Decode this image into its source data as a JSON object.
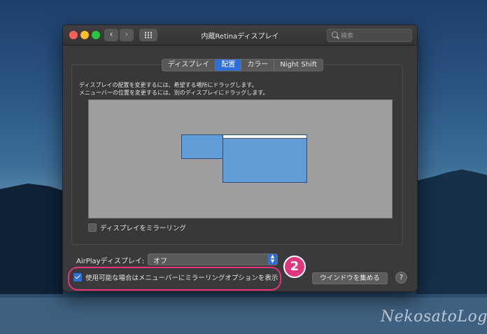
{
  "watermark": "NekosatoLog",
  "window": {
    "title": "内蔵Retinaディスプレイ",
    "nav_back": "‹",
    "nav_forward": "›",
    "search_placeholder": "検索"
  },
  "tabs": [
    {
      "label": "ディスプレイ",
      "active": false
    },
    {
      "label": "配置",
      "active": true
    },
    {
      "label": "カラー",
      "active": false
    },
    {
      "label": "Night Shift",
      "active": false
    }
  ],
  "arrangement": {
    "instruction_line1": "ディスプレイの配置を変更するには、希望する場所にドラッグします。",
    "instruction_line2": "メニューバーの位置を変更するには、別のディスプレイにドラッグします。",
    "mirror_label": "ディスプレイをミラーリング",
    "mirror_checked": false
  },
  "airplay": {
    "label": "AirPlayディスプレイ:",
    "selected": "オフ"
  },
  "menubar_option": {
    "label": "使用可能な場合はメニューバーにミラーリングオプションを表示",
    "checked": true
  },
  "buttons": {
    "gather_windows": "ウインドウを集める",
    "help": "?"
  },
  "annotation": {
    "badge": "2",
    "accent_color": "#e3347e"
  },
  "colors": {
    "selected_tab": "#2f6ed8",
    "display_fill": "#619dd6"
  },
  "icons": {
    "traffic_lights": [
      "close-icon",
      "minimize-icon",
      "zoom-icon"
    ],
    "grid": "show-all-grid-icon",
    "search": "search-icon",
    "chevron": "updown-chevron-icon"
  }
}
